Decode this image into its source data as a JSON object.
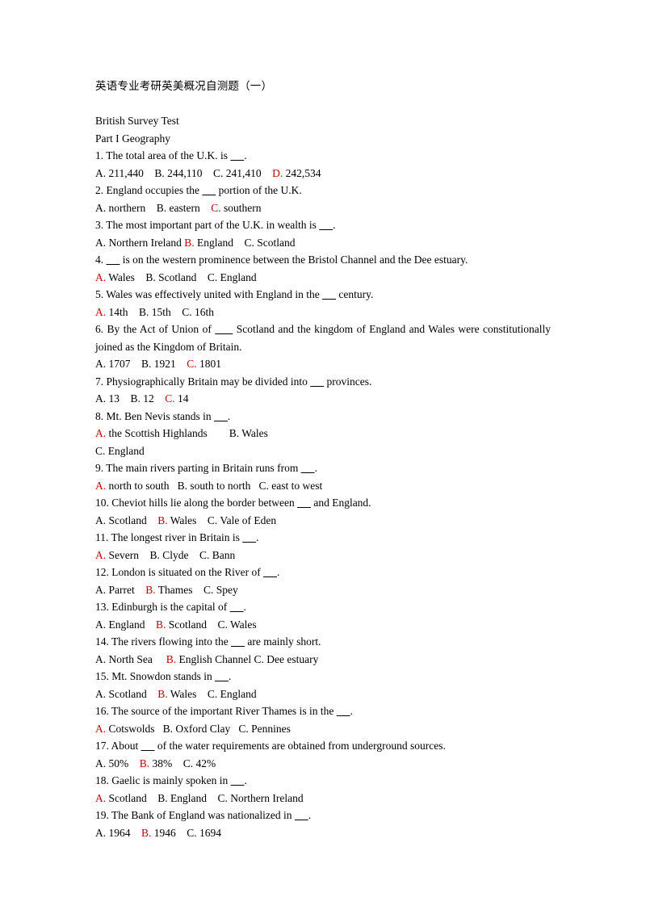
{
  "document": {
    "title": "英语专业考研英美概况自测题（一）",
    "subtitle": "British Survey Test",
    "section": "Part I Geography",
    "answer_color": "#c00000",
    "text_color": "#000000",
    "background_color": "#ffffff"
  },
  "questions": [
    {
      "number": "1.",
      "text": "1. The total area of the U.K. is _____.",
      "options_line": "A. 211,440    B. 244,110    C. 241,410    D. 242,534",
      "answer": "D",
      "options": [
        {
          "label": "A.",
          "text": "211,440"
        },
        {
          "label": "B.",
          "text": "244,110"
        },
        {
          "label": "C.",
          "text": "241,410"
        },
        {
          "label": "D.",
          "text": "242,534"
        }
      ]
    },
    {
      "number": "2.",
      "text": "2. England occupies the _____ portion of the U.K.",
      "options_line": "A. northern    B. eastern    C. southern",
      "answer": "C",
      "options": [
        {
          "label": "A.",
          "text": "northern"
        },
        {
          "label": "B.",
          "text": "eastern"
        },
        {
          "label": "C.",
          "text": "southern"
        }
      ]
    },
    {
      "number": "3.",
      "text": "3. The most important part of the U.K. in wealth is _____.",
      "options_line": "A. Northern Ireland B. England    C. Scotland",
      "answer": "B",
      "options": [
        {
          "label": "A.",
          "text": "Northern Ireland"
        },
        {
          "label": "B.",
          "text": "England"
        },
        {
          "label": "C.",
          "text": "Scotland"
        }
      ]
    },
    {
      "number": "4.",
      "text": "4. _____ is on the western prominence between the Bristol Channel and the Dee estuary.",
      "options_line": "A. Wales    B. Scotland    C. England",
      "answer": "A",
      "options": [
        {
          "label": "A.",
          "text": "Wales"
        },
        {
          "label": "B.",
          "text": "Scotland"
        },
        {
          "label": "C.",
          "text": "England"
        }
      ]
    },
    {
      "number": "5.",
      "text": "5. Wales was effectively united with England in the _____ century.",
      "options_line": "A. 14th    B. 15th    C. 16th",
      "answer": "A",
      "options": [
        {
          "label": "A.",
          "text": "14th"
        },
        {
          "label": "B.",
          "text": "15th"
        },
        {
          "label": "C.",
          "text": "16th"
        }
      ]
    },
    {
      "number": "6.",
      "text": "6. By the Act of Union of _____ Scotland and the kingdom of England and Wales were constitutionally joined as the Kingdom of Britain.",
      "justified": true,
      "options_line": "A. 1707    B. 1921    C. 1801",
      "answer": "C",
      "options": [
        {
          "label": "A.",
          "text": "1707"
        },
        {
          "label": "B.",
          "text": "1921"
        },
        {
          "label": "C.",
          "text": "1801"
        }
      ]
    },
    {
      "number": "7.",
      "text": "7. Physiographically Britain may be divided into _____ provinces.",
      "options_line": "A. 13    B. 12    C. 14",
      "answer": "C",
      "options": [
        {
          "label": "A.",
          "text": "13"
        },
        {
          "label": "B.",
          "text": "12"
        },
        {
          "label": "C.",
          "text": "14"
        }
      ]
    },
    {
      "number": "8.",
      "text": "8. Mt. Ben Nevis stands in _____.",
      "options_line": "A. the Scottish Highlands        B. Wales\nC. England",
      "answer": "A",
      "wrap": true,
      "options": [
        {
          "label": "A.",
          "text": "the Scottish Highlands"
        },
        {
          "label": "B.",
          "text": "Wales"
        },
        {
          "label": "C.",
          "text": "England"
        }
      ]
    },
    {
      "number": "9.",
      "text": "9. The main rivers parting in Britain runs from _____.",
      "options_line": "A. north to south   B. south to north   C. east to west",
      "answer": "A",
      "options": [
        {
          "label": "A.",
          "text": "north to south"
        },
        {
          "label": "B.",
          "text": "south to north"
        },
        {
          "label": "C.",
          "text": "east to west"
        }
      ]
    },
    {
      "number": "10.",
      "text": "10. Cheviot hills lie along the border between _____ and England.",
      "options_line": "A. Scotland    B. Wales    C. Vale of Eden",
      "answer": "B",
      "options": [
        {
          "label": "A.",
          "text": "Scotland"
        },
        {
          "label": "B.",
          "text": "Wales"
        },
        {
          "label": "C.",
          "text": "Vale of Eden"
        }
      ]
    },
    {
      "number": "11.",
      "text": "11. The longest river in Britain is _____.",
      "options_line": "A. Severn    B. Clyde    C. Bann",
      "answer": "A",
      "options": [
        {
          "label": "A.",
          "text": "Severn"
        },
        {
          "label": "B.",
          "text": "Clyde"
        },
        {
          "label": "C.",
          "text": "Bann"
        }
      ]
    },
    {
      "number": "12.",
      "text": "12. London is situated on the River of _____.",
      "options_line": "A. Parret    B. Thames    C. Spey",
      "answer": "B",
      "options": [
        {
          "label": "A.",
          "text": "Parret"
        },
        {
          "label": "B.",
          "text": "Thames"
        },
        {
          "label": "C.",
          "text": "Spey"
        }
      ]
    },
    {
      "number": "13.",
      "text": "13. Edinburgh is the capital of _____.",
      "options_line": "A. England    B. Scotland    C. Wales",
      "answer": "B",
      "options": [
        {
          "label": "A.",
          "text": "England"
        },
        {
          "label": "B.",
          "text": "Scotland"
        },
        {
          "label": "C.",
          "text": "Wales"
        }
      ]
    },
    {
      "number": "14.",
      "text": "14. The rivers flowing into the _____ are mainly short.",
      "options_line": "A. North Sea     B. English Channel C. Dee estuary",
      "answer": "B",
      "options": [
        {
          "label": "A.",
          "text": "North Sea"
        },
        {
          "label": "B.",
          "text": "English Channel"
        },
        {
          "label": "C.",
          "text": "Dee estuary"
        }
      ]
    },
    {
      "number": "15.",
      "text": "15. Mt. Snowdon stands in _____.",
      "options_line": "A. Scotland    B. Wales    C. England",
      "answer": "B",
      "options": [
        {
          "label": "A.",
          "text": "Scotland"
        },
        {
          "label": "B.",
          "text": "Wales"
        },
        {
          "label": "C.",
          "text": "England"
        }
      ]
    },
    {
      "number": "16.",
      "text": "16. The source of the important River Thames is in the _____.",
      "options_line": "A. Cotswolds   B. Oxford Clay   C. Pennines",
      "answer": "A",
      "options": [
        {
          "label": "A.",
          "text": "Cotswolds"
        },
        {
          "label": "B.",
          "text": "Oxford Clay"
        },
        {
          "label": "C.",
          "text": "Pennines"
        }
      ]
    },
    {
      "number": "17.",
      "text": "17. About _____ of the water requirements are obtained from underground sources.",
      "options_line": "A. 50%    B. 38%    C. 42%",
      "answer": "B",
      "options": [
        {
          "label": "A.",
          "text": "50%"
        },
        {
          "label": "B.",
          "text": "38%"
        },
        {
          "label": "C.",
          "text": "42%"
        }
      ]
    },
    {
      "number": "18.",
      "text": "18. Gaelic is mainly spoken in _____.",
      "options_line": "A. Scotland    B. England    C. Northern Ireland",
      "answer": "A",
      "options": [
        {
          "label": "A.",
          "text": "Scotland"
        },
        {
          "label": "B.",
          "text": "England"
        },
        {
          "label": "C.",
          "text": "Northern Ireland"
        }
      ]
    },
    {
      "number": "19.",
      "text": "19. The Bank of England was nationalized in _____.",
      "options_line": "A. 1964    B. 1946    C. 1694",
      "answer": "B",
      "options": [
        {
          "label": "A.",
          "text": "1964"
        },
        {
          "label": "B.",
          "text": "1946"
        },
        {
          "label": "C.",
          "text": "1694"
        }
      ]
    }
  ]
}
